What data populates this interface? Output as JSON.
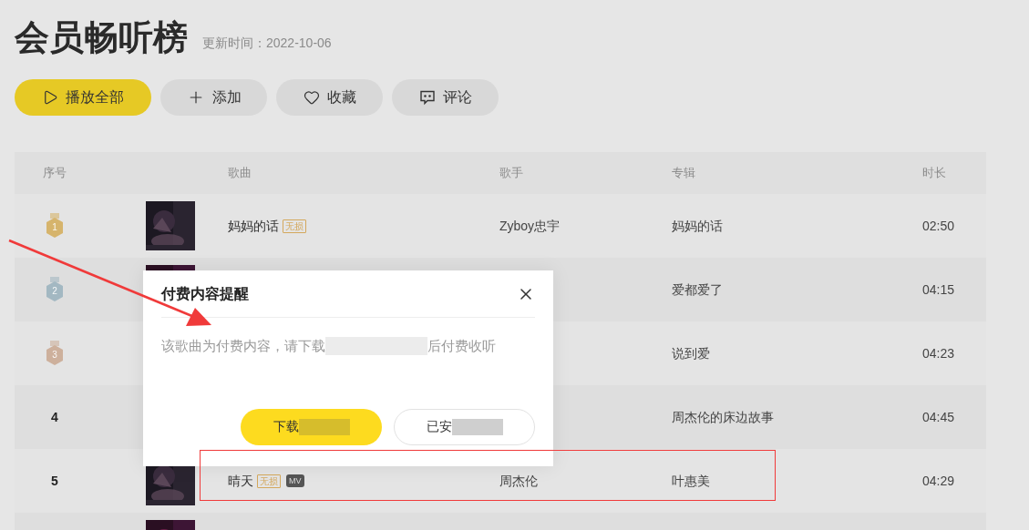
{
  "header": {
    "title": "会员畅听榜",
    "updated": "更新时间：2022-10-06"
  },
  "actions": [
    {
      "kind": "play",
      "label": "播放全部"
    },
    {
      "kind": "add",
      "label": "添加"
    },
    {
      "kind": "favorite",
      "label": "收藏"
    },
    {
      "kind": "comment",
      "label": "评论"
    }
  ],
  "table": {
    "columns": [
      "序号",
      "歌曲",
      "歌手",
      "专辑",
      "时长"
    ],
    "rows": [
      {
        "rank": {
          "kind": "medal",
          "label": "1",
          "color": "#d6b46c"
        },
        "cover": true,
        "song": {
          "title": "妈妈的话",
          "tags": [
            {
              "kind": "lossless",
              "label": "无损"
            }
          ]
        },
        "singer": "Zyboy忠宇",
        "album": "妈妈的话",
        "duration": "02:50"
      },
      {
        "rank": {
          "kind": "medal",
          "label": "2",
          "color": "#a3b8c2"
        },
        "cover": true,
        "album": "爱都爱了",
        "duration": "04:15"
      },
      {
        "rank": {
          "kind": "medal",
          "label": "3",
          "color": "#cdb09c"
        },
        "cover": false,
        "album": "说到爱",
        "duration": "04:23"
      },
      {
        "rank": {
          "kind": "plain",
          "label": "4"
        },
        "cover": false,
        "album": "周杰伦的床边故事",
        "duration": "04:45"
      },
      {
        "rank": {
          "kind": "plain",
          "label": "5"
        },
        "cover": true,
        "song": {
          "title": "晴天",
          "tags": [
            {
              "kind": "lossless",
              "label": "无损"
            },
            {
              "kind": "mv",
              "label": "MV"
            }
          ]
        },
        "singer": "周杰伦",
        "album": "叶惠美",
        "duration": "04:29"
      },
      {
        "cover": true
      }
    ]
  },
  "dialog": {
    "title": "付费内容提醒",
    "message_parts": [
      "该歌曲为付费内容，请下载",
      "后付费收听"
    ],
    "buttons": [
      {
        "kind": "primary",
        "label": "下载"
      },
      {
        "kind": "secondary",
        "label": "已安"
      }
    ]
  }
}
